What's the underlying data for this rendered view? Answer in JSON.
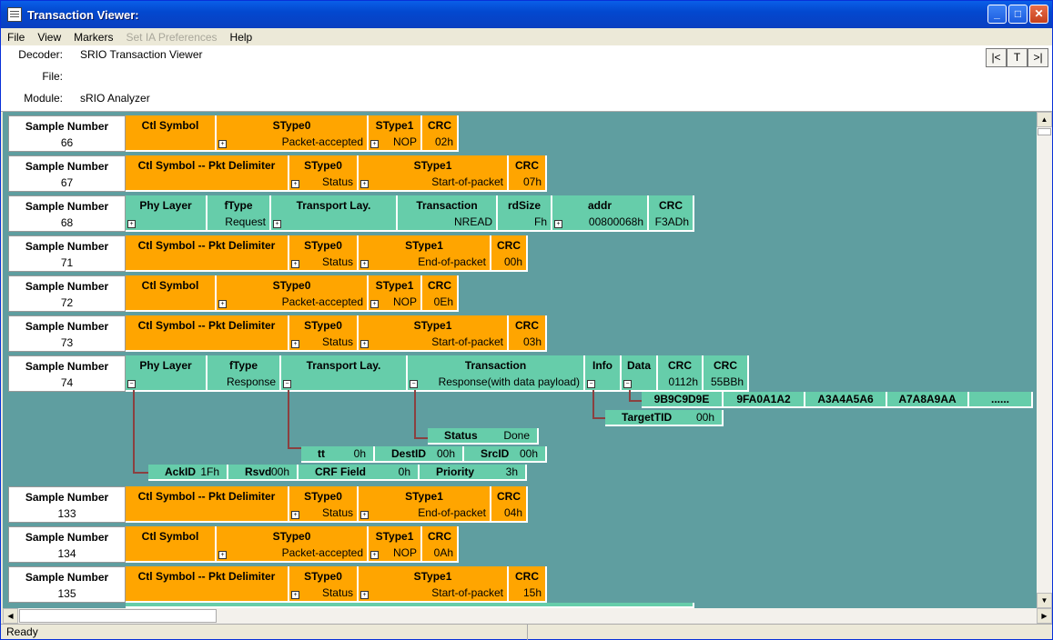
{
  "window": {
    "title": "Transaction Viewer:"
  },
  "menu": [
    {
      "label": "File",
      "disabled": false
    },
    {
      "label": "View",
      "disabled": false
    },
    {
      "label": "Markers",
      "disabled": false
    },
    {
      "label": "Set IA Preferences",
      "disabled": true
    },
    {
      "label": "Help",
      "disabled": false
    }
  ],
  "info": {
    "decoder_label": "Decoder:",
    "decoder_value": "SRIO Transaction Viewer",
    "file_label": "File:",
    "file_value": "",
    "module_label": "Module:",
    "module_value": "sRIO Analyzer"
  },
  "nav": [
    "|<",
    "T",
    ">|"
  ],
  "colors": {
    "control": "#ffa500",
    "packet": "#66cdaa",
    "background": "#5f9ea0",
    "connector": "#8b4040"
  },
  "rows": [
    {
      "sample_label": "Sample Number",
      "sample": "66",
      "kind": "ctl-basic",
      "fields": [
        {
          "h": "Ctl Symbol",
          "v": ""
        },
        {
          "h": "SType0",
          "v": "Packet-accepted"
        },
        {
          "h": "SType1",
          "v": "NOP"
        },
        {
          "h": "CRC",
          "v": "02h"
        }
      ]
    },
    {
      "sample_label": "Sample Number",
      "sample": "67",
      "kind": "ctl-delim",
      "fields": [
        {
          "h": "Ctl Symbol -- Pkt Delimiter",
          "v": ""
        },
        {
          "h": "SType0",
          "v": "Status"
        },
        {
          "h": "SType1",
          "v": "Start-of-packet"
        },
        {
          "h": "CRC",
          "v": "07h"
        }
      ]
    },
    {
      "sample_label": "Sample Number",
      "sample": "68",
      "kind": "pkt-req",
      "fields": [
        {
          "h": "Phy Layer",
          "v": ""
        },
        {
          "h": "fType",
          "v": "Request"
        },
        {
          "h": "Transport Lay.",
          "v": ""
        },
        {
          "h": "Transaction",
          "v": "NREAD"
        },
        {
          "h": "rdSize",
          "v": "Fh"
        },
        {
          "h": "addr",
          "v": "00800068h"
        },
        {
          "h": "CRC",
          "v": "F3ADh"
        }
      ]
    },
    {
      "sample_label": "Sample Number",
      "sample": "71",
      "kind": "ctl-delim-end",
      "fields": [
        {
          "h": "Ctl Symbol -- Pkt Delimiter",
          "v": ""
        },
        {
          "h": "SType0",
          "v": "Status"
        },
        {
          "h": "SType1",
          "v": "End-of-packet"
        },
        {
          "h": "CRC",
          "v": "00h"
        }
      ]
    },
    {
      "sample_label": "Sample Number",
      "sample": "72",
      "kind": "ctl-basic",
      "fields": [
        {
          "h": "Ctl Symbol",
          "v": ""
        },
        {
          "h": "SType0",
          "v": "Packet-accepted"
        },
        {
          "h": "SType1",
          "v": "NOP"
        },
        {
          "h": "CRC",
          "v": "0Eh"
        }
      ]
    },
    {
      "sample_label": "Sample Number",
      "sample": "73",
      "kind": "ctl-delim",
      "fields": [
        {
          "h": "Ctl Symbol -- Pkt Delimiter",
          "v": ""
        },
        {
          "h": "SType0",
          "v": "Status"
        },
        {
          "h": "SType1",
          "v": "Start-of-packet"
        },
        {
          "h": "CRC",
          "v": "03h"
        }
      ]
    },
    {
      "sample_label": "Sample Number",
      "sample": "74",
      "kind": "pkt-resp",
      "fields": [
        {
          "h": "Phy Layer",
          "v": ""
        },
        {
          "h": "fType",
          "v": "Response"
        },
        {
          "h": "Transport Lay.",
          "v": ""
        },
        {
          "h": "Transaction",
          "v": "Response(with data payload)"
        },
        {
          "h": "Info",
          "v": ""
        },
        {
          "h": "Data",
          "v": ""
        },
        {
          "h": "CRC",
          "v": "0112h"
        },
        {
          "h": "CRC",
          "v": "55BBh"
        }
      ]
    },
    {
      "sample_label": "Sample Number",
      "sample": "133",
      "kind": "ctl-delim-end",
      "fields": [
        {
          "h": "Ctl Symbol -- Pkt Delimiter",
          "v": ""
        },
        {
          "h": "SType0",
          "v": "Status"
        },
        {
          "h": "SType1",
          "v": "End-of-packet"
        },
        {
          "h": "CRC",
          "v": "04h"
        }
      ]
    },
    {
      "sample_label": "Sample Number",
      "sample": "134",
      "kind": "ctl-basic",
      "fields": [
        {
          "h": "Ctl Symbol",
          "v": ""
        },
        {
          "h": "SType0",
          "v": "Packet-accepted"
        },
        {
          "h": "SType1",
          "v": "NOP"
        },
        {
          "h": "CRC",
          "v": "0Ah"
        }
      ]
    },
    {
      "sample_label": "Sample Number",
      "sample": "135",
      "kind": "ctl-delim",
      "fields": [
        {
          "h": "Ctl Symbol -- Pkt Delimiter",
          "v": ""
        },
        {
          "h": "SType0",
          "v": "Status"
        },
        {
          "h": "SType1",
          "v": "Start-of-packet"
        },
        {
          "h": "CRC",
          "v": "15h"
        }
      ]
    }
  ],
  "expanded": {
    "data_words": [
      "9B9C9D9E",
      "9FA0A1A2",
      "A3A4A5A6",
      "A7A8A9AA",
      "......"
    ],
    "target_tid": {
      "k": "TargetTID",
      "v": "00h"
    },
    "status": {
      "k": "Status",
      "v": "Done"
    },
    "transport": [
      {
        "k": "tt",
        "v": "0h"
      },
      {
        "k": "DestID",
        "v": "00h"
      },
      {
        "k": "SrcID",
        "v": "00h"
      }
    ],
    "phy": [
      {
        "k": "AckID",
        "v": "1Fh"
      },
      {
        "k": "Rsvd",
        "v": "00h"
      },
      {
        "k": "CRF Field",
        "v": "0h"
      },
      {
        "k": "Priority",
        "v": "3h"
      }
    ]
  },
  "status_bar": {
    "text": "Ready"
  }
}
